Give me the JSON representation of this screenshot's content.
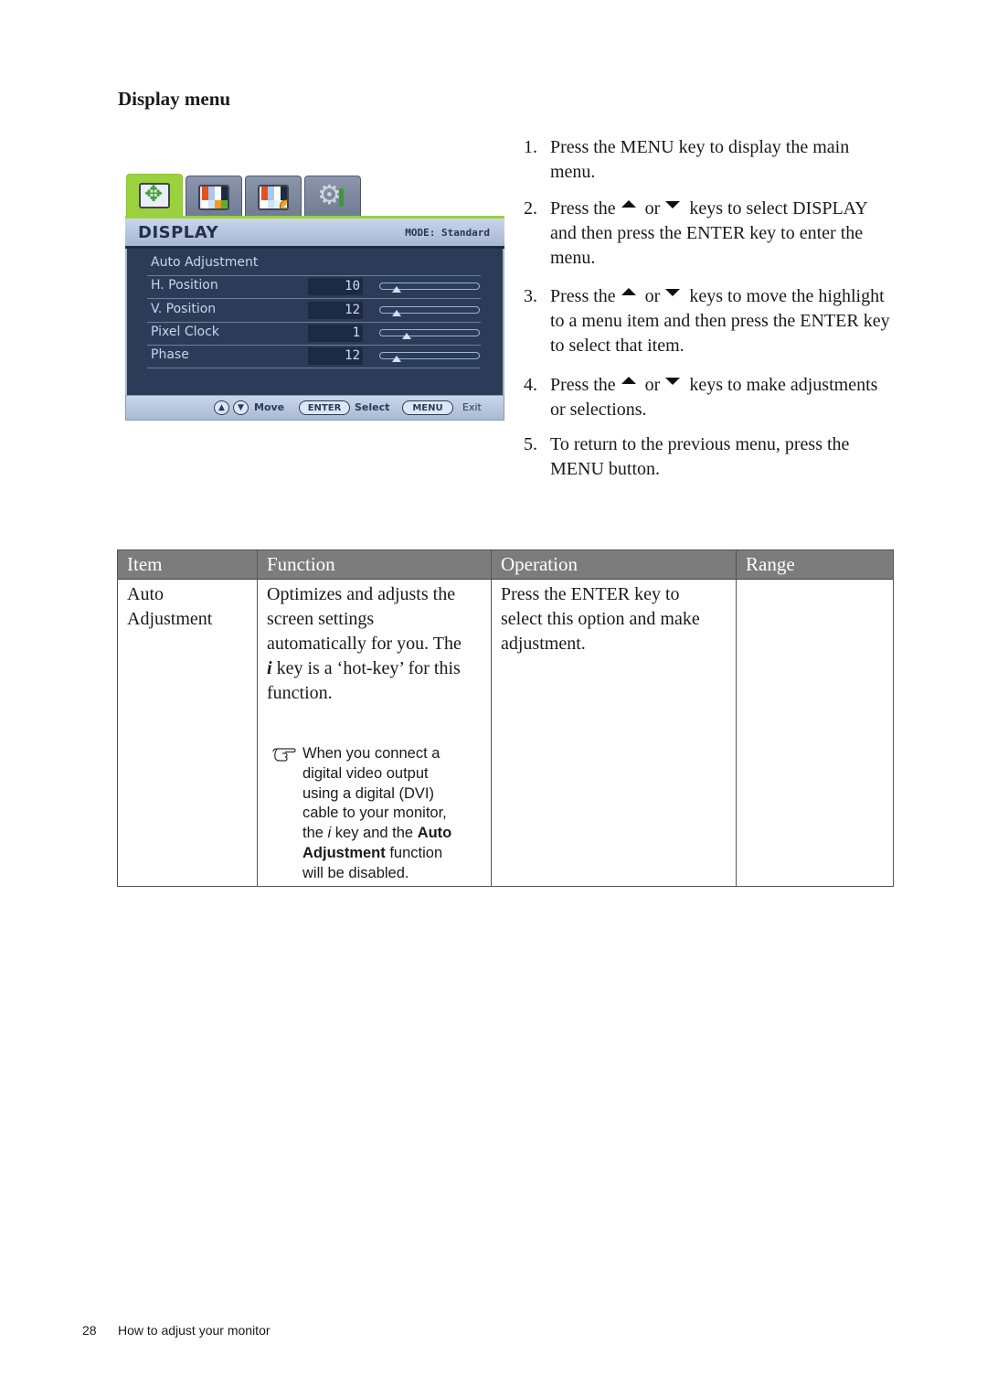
{
  "section_title": "Display menu",
  "osd": {
    "tabs": [
      {
        "icon": "display-position-icon",
        "active": true
      },
      {
        "icon": "picture-icon",
        "active": false
      },
      {
        "icon": "picture-advanced-icon",
        "active": false
      },
      {
        "icon": "system-settings-icon",
        "active": false
      }
    ],
    "title": "DISPLAY",
    "mode": "MODE: Standard",
    "items": [
      {
        "label": "Auto Adjustment"
      },
      {
        "label": "H. Position",
        "value": "10",
        "slider_fraction": 0.12
      },
      {
        "label": "V. Position",
        "value": "12",
        "slider_fraction": 0.12
      },
      {
        "label": "Pixel Clock",
        "value": "1",
        "slider_fraction": 0.22
      },
      {
        "label": "Phase",
        "value": "12",
        "slider_fraction": 0.12
      }
    ],
    "footer": {
      "up_key": "▲",
      "down_key": "▼",
      "move_label": "Move",
      "enter_key": "ENTER",
      "select_label": "Select",
      "menu_key": "MENU",
      "exit_label": "Exit"
    }
  },
  "steps": [
    {
      "num": "1.",
      "parts": [
        "Press the ",
        "MENU",
        " key to display the main menu."
      ]
    },
    {
      "num": "2.",
      "parts": [
        "Press the",
        "or",
        "keys to select ",
        "DISPLAY",
        " and then press the ",
        "ENTER",
        " key to enter the menu."
      ]
    },
    {
      "num": "3.",
      "parts": [
        "Press the",
        "or",
        "keys to move the highlight to a menu item and then press the ",
        "ENTER",
        " key to select that item."
      ]
    },
    {
      "num": "4.",
      "parts": [
        "Press the",
        "or",
        "keys to make adjustments or selections."
      ]
    },
    {
      "num": "5.",
      "parts": [
        "To return to the previous menu, press the ",
        "MENU",
        " button."
      ]
    }
  ],
  "table": {
    "headers": [
      "Item",
      "Function",
      "Operation",
      "Range"
    ],
    "rows": [
      {
        "item": [
          "Auto",
          "Adjustment"
        ],
        "function": {
          "lines": [
            "Optimizes and adjusts the",
            "screen settings",
            "automatically for you. The"
          ],
          "hotkey": "i",
          "hotkey_line": " key is a ‘hot-key’ for this",
          "last_line": "function.",
          "note": {
            "icon": "pointing-hand-icon",
            "lines": [
              "When you connect a",
              "digital video output",
              "using a digital (DVI)",
              "cable to your monitor,"
            ],
            "line5_pre": "the ",
            "line5_italic": "i",
            "line5_mid": " key and the ",
            "line5_bold": "Auto",
            "line6_bold": "Adjustment",
            "line6_post": " function",
            "line7": "will be disabled."
          }
        },
        "operation": {
          "pre": "Press the ",
          "bold": "ENTER",
          "post": " key to",
          "lines": [
            "select this option and make",
            "adjustment."
          ]
        },
        "range": ""
      }
    ]
  },
  "footer": {
    "page_number": "28",
    "chapter": "How to adjust your monitor"
  }
}
